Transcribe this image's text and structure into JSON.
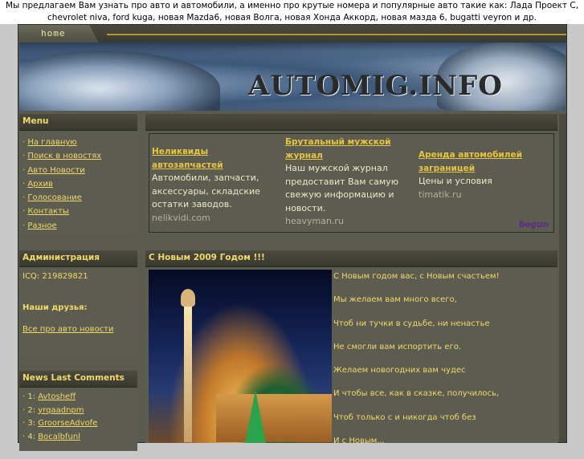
{
  "intro_text": "Мы предлагаем Вам узнать про авто и автомобили, а именно про крутые номера и популярные авто такие как: Лада Проект С, chevrolet niva, ford kuga, новая Mazda6, новая Волга, новая Хонда Аккорд, новая мазда 6, bugatti veyron и др.",
  "nav": {
    "home": "home"
  },
  "banner": {
    "logo": "AUTOMIG.INFO"
  },
  "menu": {
    "title": "Menu",
    "items": [
      "На главную",
      "Поиск в новостях",
      "Авто Новости",
      "Архив",
      "Голосование",
      "Контакты",
      "Разное"
    ]
  },
  "admin": {
    "title": "Администрация",
    "icq": "ICQ: 219829821",
    "friends_title": "Наши друзья:",
    "friend_link": "Все про авто новости"
  },
  "comments": {
    "title": "News Last Comments",
    "items": [
      {
        "num": "1:",
        "name": "Avtosheff"
      },
      {
        "num": "2:",
        "name": "yrqaadnpm"
      },
      {
        "num": "3:",
        "name": "GroorseAdvofe"
      },
      {
        "num": "4:",
        "name": "Bocalbfunl"
      }
    ]
  },
  "ads": {
    "items": [
      {
        "title": "Неликвиды автозапчастей",
        "text": "Автомобили, запчасти, аксессуары, складские остатки заводов.",
        "domain": "nelikvidi.com"
      },
      {
        "title": "Брутальный мужской журнал",
        "text": "Наш мужской журнал предоставит Вам самую свежую информацию и новости.",
        "domain": "heavyman.ru"
      },
      {
        "title": "Аренда автомобилей заграницей",
        "text": "Цены и условия",
        "domain": "timatik.ru"
      }
    ],
    "brand": "begun"
  },
  "news": {
    "title": "С Новым 2009 Годом !!!",
    "lines": [
      "С Новым годом вас, с Новым счастьем!",
      "Мы желаем вам много всего,",
      "Чтоб ни тучки в судьбе, ни ненастье",
      "Не смогли вам испортить его.",
      "Желаем новогодних вам чудес",
      "И чтобы все, как в сказке, получилось,",
      "Чтоб только с и никогда чтоб без",
      "И с Новым..."
    ]
  }
}
